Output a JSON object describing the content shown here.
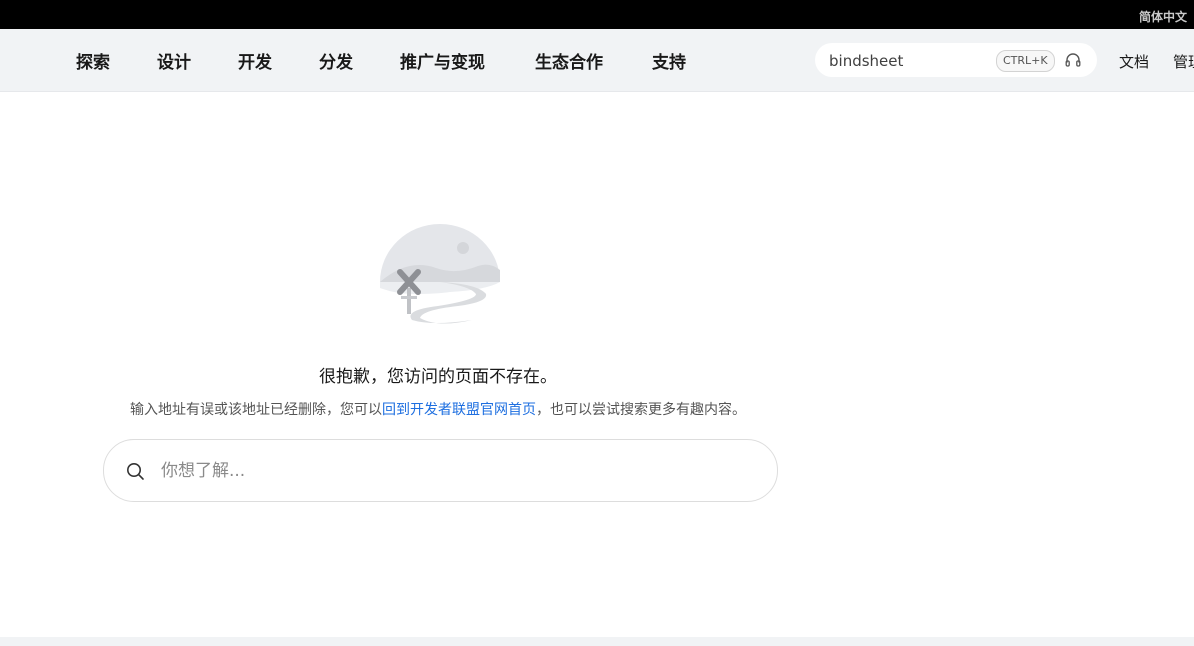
{
  "topbar": {
    "language": "简体中文"
  },
  "nav": {
    "items": [
      "探索",
      "设计",
      "开发",
      "分发",
      "推广与变现",
      "生态合作",
      "支持"
    ],
    "search": {
      "value": "bindsheet",
      "shortcut": "CTRL+K",
      "icon": "headset-icon"
    },
    "links": [
      "文档",
      "管理中心"
    ]
  },
  "error": {
    "title": "很抱歉，您访问的页面不存在。",
    "desc_prefix": "输入地址有误或该地址已经删除，您可以",
    "desc_link": "回到开发者联盟官网首页",
    "desc_suffix": "，也可以尝试搜索更多有趣内容。"
  },
  "main_search": {
    "placeholder": "你想了解...",
    "icon": "search-icon"
  },
  "colors": {
    "accent": "#1e6fe0",
    "nav_bg": "#f1f3f5",
    "topbar_bg": "#000000"
  }
}
